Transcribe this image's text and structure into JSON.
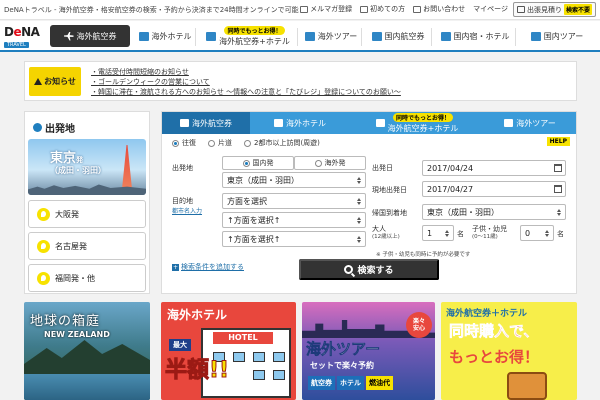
{
  "topstrip": {
    "tagline": "DeNAトラベル - 海外航空券・格安航空券の検索・予約から決済まで24時間オンラインで可能！",
    "links": [
      "メルマガ登録",
      "初めての方",
      "お問い合わせ",
      "マイページ"
    ],
    "quote_label": "出張見積り",
    "quote_badge": "検索不要"
  },
  "logo": {
    "brand_prefix": "D",
    "brand_accent": "e",
    "brand_suffix": "NA",
    "sub": "TRAVEL"
  },
  "nav": {
    "items": [
      {
        "label": "海外航空券",
        "pill": ""
      },
      {
        "label": "海外ホテル",
        "pill": ""
      },
      {
        "label": "海外航空券+ホテル",
        "pill": "同時でもっとお得！"
      },
      {
        "label": "海外ツアー",
        "pill": ""
      },
      {
        "label": "国内航空券",
        "pill": ""
      },
      {
        "label": "国内宿・ホテル",
        "pill": ""
      },
      {
        "label": "国内ツアー",
        "pill": ""
      }
    ]
  },
  "notice": {
    "label": "お知らせ",
    "items": [
      "・電話受付時間短縮のお知らせ",
      "・ゴールデンウィークの営業について",
      "・韓国に滞在・渡航される方へのお知らせ ～情報への注意と「たびレジ」登録についてのお願い～"
    ]
  },
  "departure": {
    "title": "出発地",
    "featured_city": "東京",
    "featured_suffix": "発",
    "featured_airports": "（成田・羽田）",
    "options": [
      "大阪発",
      "名古屋発",
      "福岡発・他"
    ]
  },
  "search": {
    "tabs": [
      {
        "label": "海外航空券",
        "pill": ""
      },
      {
        "label": "海外ホテル",
        "pill": ""
      },
      {
        "label": "海外航空券+ホテル",
        "pill": "同時でもっとお得！"
      },
      {
        "label": "海外ツアー",
        "pill": ""
      }
    ],
    "trip_types": [
      "往復",
      "片道",
      "2都市以上訪問(周遊)"
    ],
    "help_label": "HELP",
    "origin_label": "出発地",
    "origin_scope": [
      "国内発",
      "海外発"
    ],
    "origin_value": "東京（成田・羽田）",
    "dest_label": "目的地",
    "dest_sub": "都市名入力",
    "dest_values": [
      "方面を選択",
      "↑方面を選択↑",
      "↑方面を選択↑"
    ],
    "depart_date_label": "出発日",
    "depart_date_value": "2017/04/24",
    "local_depart_label": "現地出発日",
    "local_depart_value": "2017/04/27",
    "return_airport_label": "帰国到着地",
    "return_airport_value": "東京（成田・羽田）",
    "adult_label": "大人",
    "adult_sub": "(12歳以上)",
    "adult_value": "1",
    "child_label": "子供・幼児",
    "child_sub": "(0～11歳)",
    "child_value": "0",
    "unit": "名",
    "child_note": "※ 子供・幼児も同時に予約が必要です",
    "add_condition": "検索条件を追加する",
    "submit_label": "検索する"
  },
  "banners": {
    "b1": {
      "title": "地球の箱庭",
      "subtitle": "NEW ZEALAND"
    },
    "b2": {
      "title": "海外ホテル",
      "sign": "HOTEL",
      "max": "最大",
      "headline": "半額!!"
    },
    "b3": {
      "badge_top": "楽々",
      "badge_bottom": "安心",
      "title": "海外ツアー",
      "subtitle": "セットで楽々予約",
      "tags": [
        "航空券",
        "ホテル",
        "燃油代"
      ]
    },
    "b4": {
      "title": "海外航空券＋ホテル",
      "line1": "同時購入で、",
      "line2": "もっとお得！"
    }
  }
}
